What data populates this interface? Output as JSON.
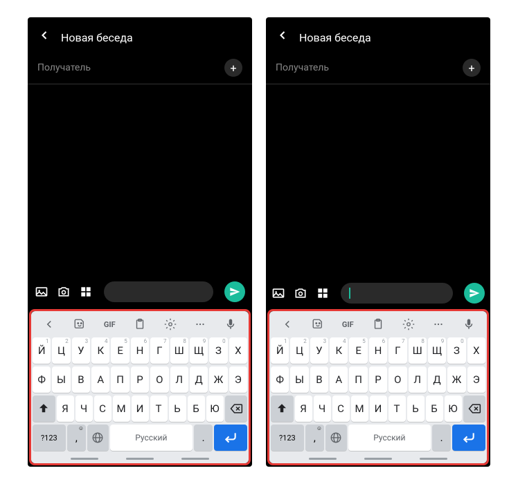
{
  "header": {
    "title": "Новая беседа"
  },
  "recipient": {
    "placeholder": "Получатель"
  },
  "keyboard": {
    "gif": "GIF",
    "row1": [
      "Й",
      "Ц",
      "У",
      "К",
      "Е",
      "Н",
      "Г",
      "Ш",
      "Щ",
      "З",
      "Х"
    ],
    "row1sup": [
      "1",
      "2",
      "3",
      "4",
      "5",
      "6",
      "7",
      "8",
      "9",
      "0",
      ""
    ],
    "row2": [
      "Ф",
      "Ы",
      "В",
      "А",
      "П",
      "Р",
      "О",
      "Л",
      "Д",
      "Ж",
      "Э"
    ],
    "row3": [
      "Я",
      "Ч",
      "С",
      "М",
      "И",
      "Т",
      "Ь",
      "Б",
      "Ю"
    ],
    "k123": "?123",
    "comma": ",",
    "space": "Русский",
    "dot": "."
  }
}
